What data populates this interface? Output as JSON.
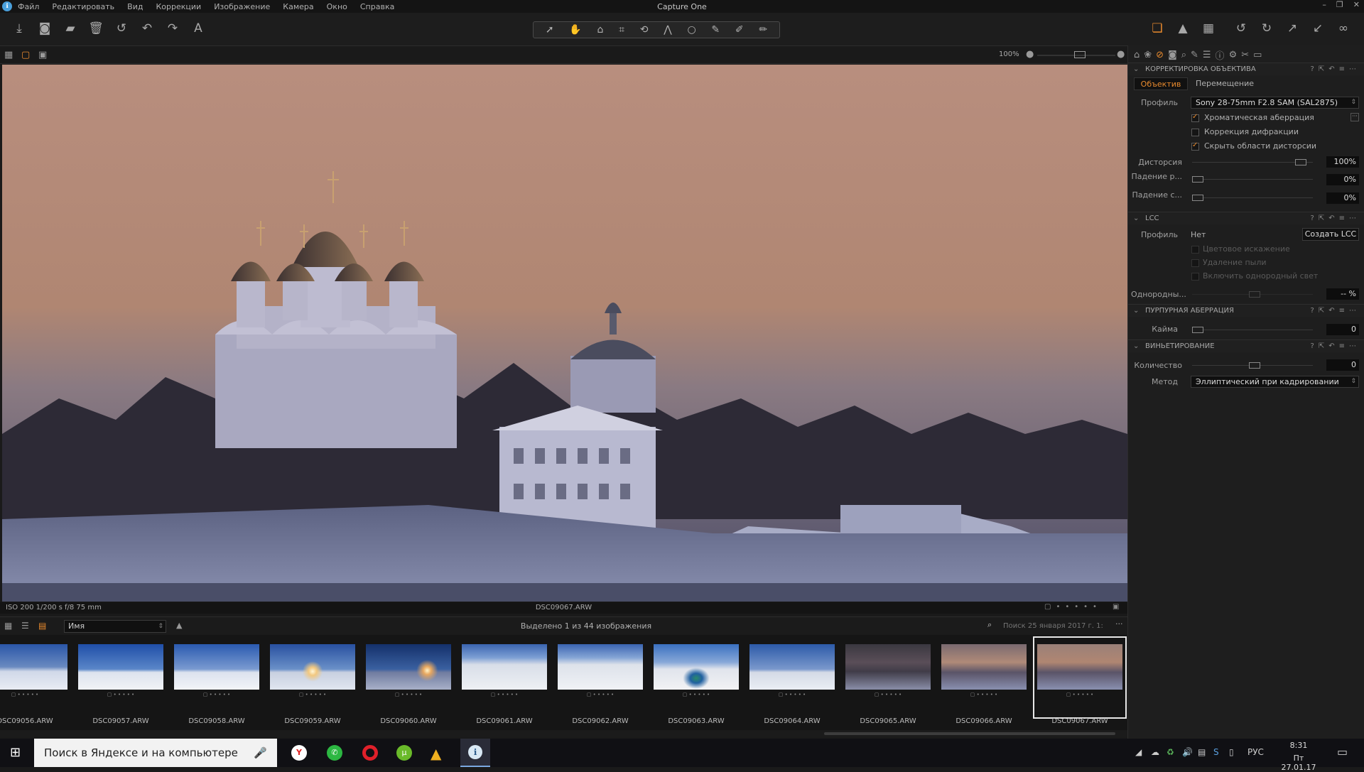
{
  "app": {
    "title": "Capture One"
  },
  "menu": [
    "Файл",
    "Редактировать",
    "Вид",
    "Коррекции",
    "Изображение",
    "Камера",
    "Окно",
    "Справка"
  ],
  "viewbar": {
    "zoom": "100%"
  },
  "viewer": {
    "info": "ISO 200  1/200 s  f/8  75 mm",
    "filename": "DSC09067.ARW"
  },
  "browser": {
    "sort": "Имя",
    "selection": "Выделено 1 из 44 изображения",
    "search_placeholder": "Поиск 25 января 2017 г. 1:"
  },
  "thumbnails": [
    {
      "name": "DSC09056.ARW"
    },
    {
      "name": "DSC09057.ARW"
    },
    {
      "name": "DSC09058.ARW"
    },
    {
      "name": "DSC09059.ARW"
    },
    {
      "name": "DSC09060.ARW"
    },
    {
      "name": "DSC09061.ARW"
    },
    {
      "name": "DSC09062.ARW"
    },
    {
      "name": "DSC09063.ARW"
    },
    {
      "name": "DSC09064.ARW"
    },
    {
      "name": "DSC09065.ARW"
    },
    {
      "name": "DSC09066.ARW"
    },
    {
      "name": "DSC09067.ARW"
    }
  ],
  "lens": {
    "title": "КОРРЕКТИРОВКА ОБЪЕКТИВА",
    "tab_lens": "Объектив",
    "tab_movement": "Перемещение",
    "profile_label": "Профиль",
    "profile_value": "Sony 28-75mm F2.8 SAM (SAL2875)",
    "chromatic": "Хроматическая аберрация",
    "diffraction": "Коррекция дифракции",
    "hide_distortion": "Скрыть области дисторсии",
    "distortion_label": "Дисторсия",
    "distortion_value": "100%",
    "falloff_r_label": "Падение р...",
    "falloff_r_value": "0%",
    "falloff_s_label": "Падение с...",
    "falloff_s_value": "0%"
  },
  "lcc": {
    "title": "LCC",
    "profile_label": "Профиль",
    "profile_value": "Нет",
    "create_button": "Создать LCC",
    "color_cast": "Цветовое искажение",
    "dust": "Удаление пыли",
    "uniform_light": "Включить однородный свет",
    "uniformity_label": "Однородны...",
    "uniformity_value": "-- %"
  },
  "purple": {
    "title": "ПУРПУРНАЯ АБЕРРАЦИЯ",
    "fringe_label": "Кайма",
    "fringe_value": "0"
  },
  "vignette": {
    "title": "ВИНЬЕТИРОВАНИЕ",
    "amount_label": "Количество",
    "amount_value": "0",
    "method_label": "Метод",
    "method_value": "Эллиптический при кадрировании"
  },
  "taskbar": {
    "search": "Поиск в Яндексе и на компьютере",
    "lang": "РУС",
    "time": "8:31",
    "date": "Пт 27.01.17"
  },
  "colors": {
    "accent": "#e88a2e",
    "background": "#1a1a1a"
  }
}
